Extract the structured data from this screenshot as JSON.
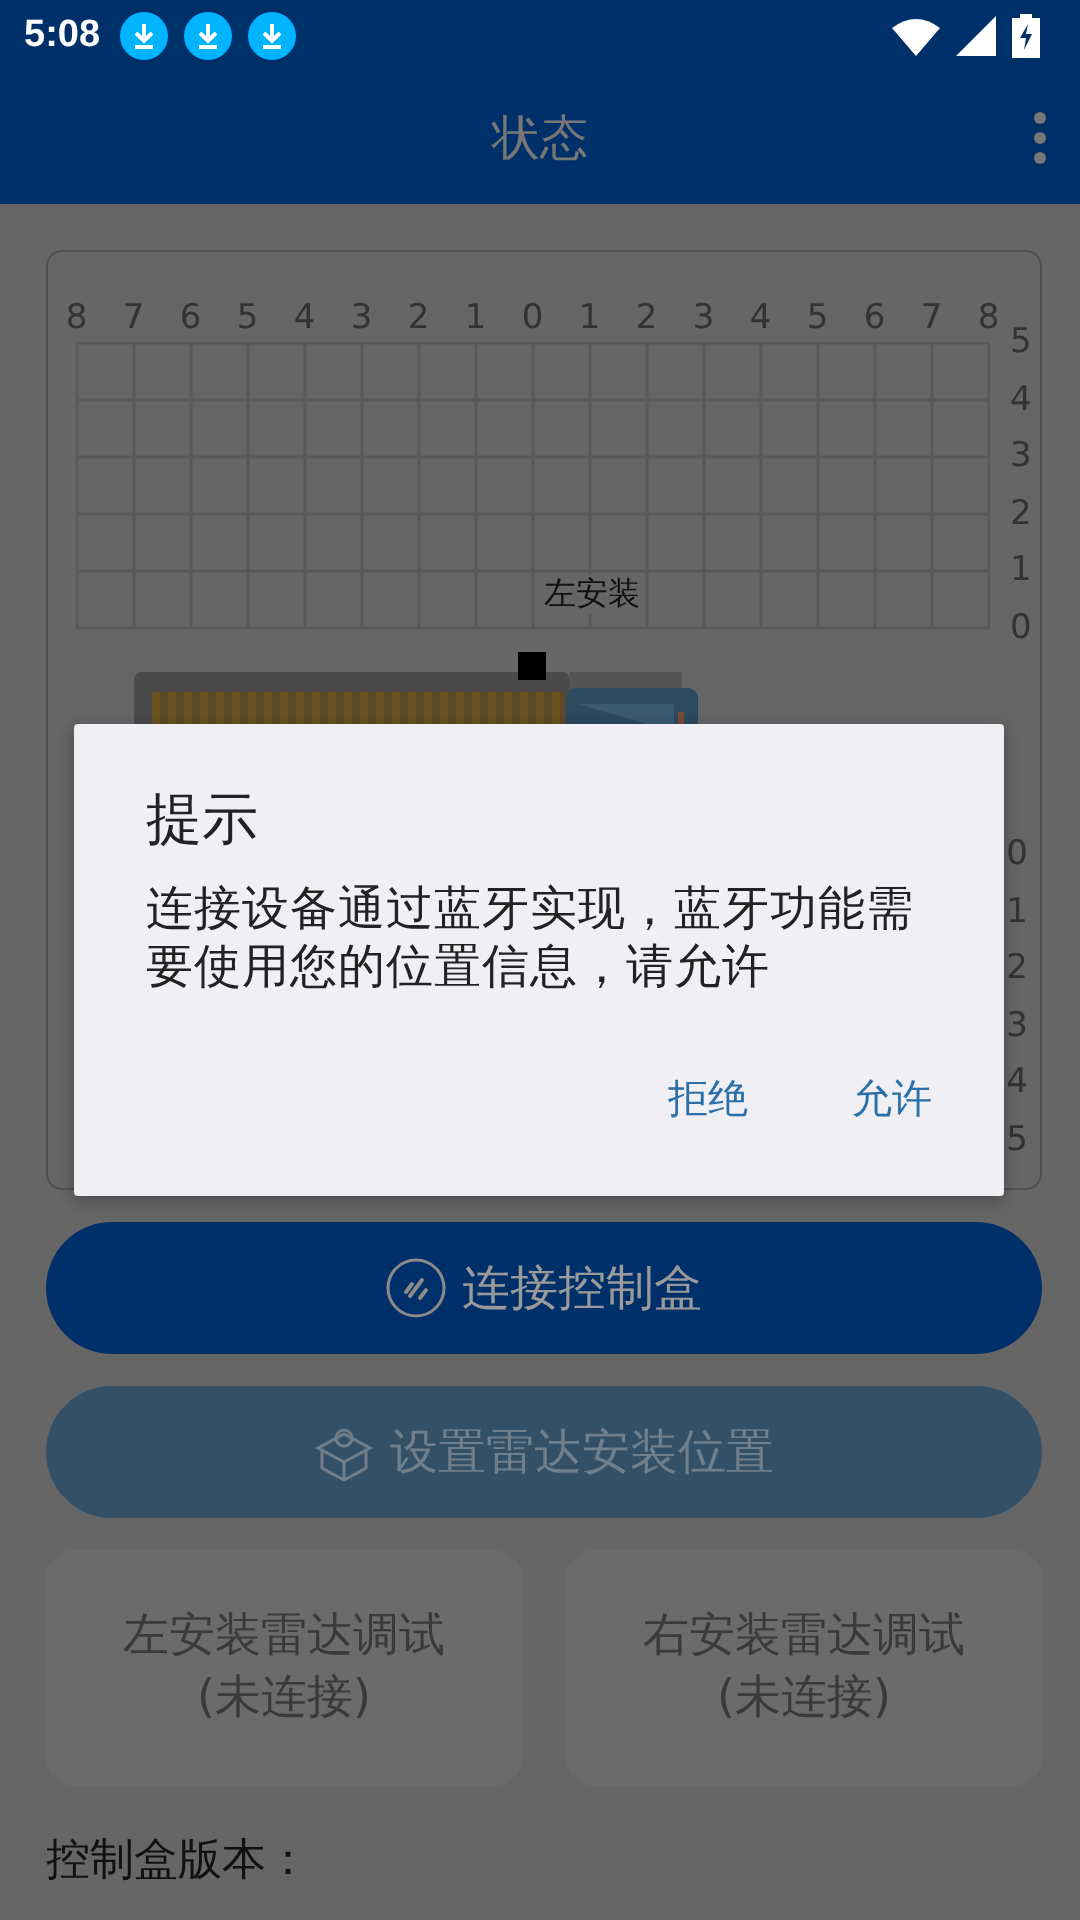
{
  "status_bar": {
    "time": "5:08"
  },
  "app_bar": {
    "title": "状态"
  },
  "radar_chart": {
    "x_labels": [
      "8",
      "7",
      "6",
      "5",
      "4",
      "3",
      "2",
      "1",
      "0",
      "1",
      "2",
      "3",
      "4",
      "5",
      "6",
      "7",
      "8"
    ],
    "upper_y_labels": [
      "5",
      "4",
      "3",
      "2",
      "1",
      "0"
    ],
    "lower_y_labels": [
      "0",
      "1",
      "2",
      "3",
      "4",
      "5"
    ],
    "mount_label": "左安装"
  },
  "buttons": [
    {
      "label": "连接控制盒",
      "kind": "connect",
      "disabled": false
    },
    {
      "label": "设置雷达安装位置",
      "kind": "position",
      "disabled": true
    }
  ],
  "debug_cards": [
    {
      "label": "左安装雷达调试",
      "status": "(未连接)",
      "disabled": true
    },
    {
      "label": "右安装雷达调试",
      "status": "(未连接)",
      "disabled": true
    }
  ],
  "version_label": "控制盒版本：",
  "dialog": {
    "title": "提示",
    "message": "连接设备通过蓝牙实现，蓝牙功能需要使用您的位置信息，请允许",
    "actions": [
      "拒绝",
      "允许"
    ]
  }
}
